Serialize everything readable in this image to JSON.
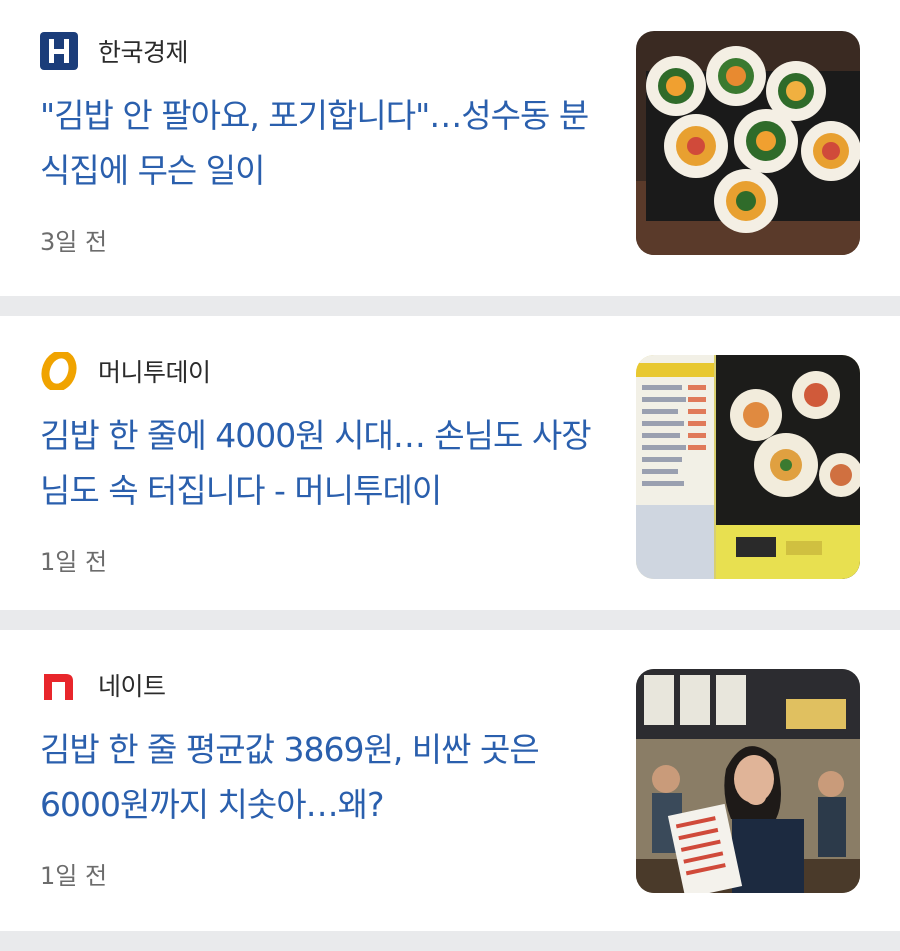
{
  "articles": [
    {
      "source": "한국경제",
      "logo_icon": "hankyung-logo-icon",
      "title": "\"김밥 안 팔아요, 포기합니다\"…성수동 분식집에 무슨 일이",
      "time": "3일 전",
      "thumbnail": "gimbap-rolls-image"
    },
    {
      "source": "머니투데이",
      "logo_icon": "moneytoday-logo-icon",
      "title": "김밥 한 줄에 4000원 시대… 손님도 사장님도 속 터집니다 - 머니투데이",
      "time": "1일 전",
      "thumbnail": "gimbap-menu-board-image"
    },
    {
      "source": "네이트",
      "logo_icon": "nate-logo-icon",
      "title": "김밥 한 줄 평균값 3869원, 비싼 곳은 6000원까지 치솟아…왜?",
      "time": "1일 전",
      "thumbnail": "woman-reading-menu-image"
    }
  ],
  "colors": {
    "title": "#2a5fad",
    "source": "#2b2b2b",
    "time": "#6c6c6c",
    "divider": "#e9eaec",
    "hankyung_logo": "#1b3d7a",
    "moneytoday_logo": "#f0a300",
    "nate_logo": "#e8262b"
  }
}
